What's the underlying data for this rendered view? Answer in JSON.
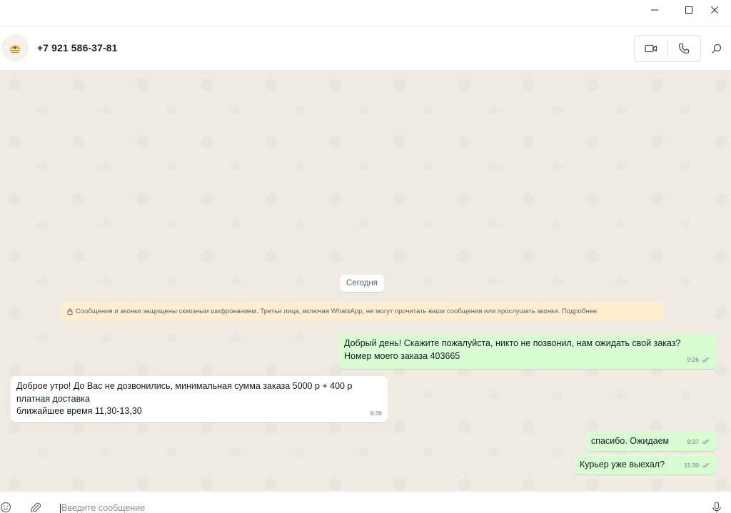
{
  "window": {
    "controls": [
      "minimize-icon",
      "maximize-icon",
      "close-icon"
    ]
  },
  "header": {
    "contact_name": "+7 921 586-37-81",
    "icons": [
      "video-call-icon",
      "voice-call-icon",
      "search-icon"
    ]
  },
  "chat": {
    "date_label": "Сегодня",
    "encryption_notice": "Сообщения и звонки защищены сквозным шифрованием. Третьи лица, включая WhatsApp, не могут прочитать ваши сообщения или прослушать звонки. Подробнее.",
    "messages": [
      {
        "direction": "outgoing",
        "text": "Добрый день! Скажите пожалуйста, никто не позвонил, нам ожидать свой заказ?\nНомер моего заказа 403665",
        "time": "9:26",
        "status": "read"
      },
      {
        "direction": "incoming",
        "text": "Доброе утро! До Вас не дозвонились, минимальная сумма заказа 5000 р + 400 р\nплатная доставка\nближайшее время 11,30-13,30",
        "time": "9:36"
      },
      {
        "direction": "outgoing",
        "text": "спасибо. Ожидаем",
        "time": "9:37",
        "status": "read"
      },
      {
        "direction": "outgoing",
        "text": "Курьер уже выехал?",
        "time": "11:30",
        "status": "read"
      }
    ]
  },
  "composer": {
    "placeholder": "Введите сообщение",
    "icons": [
      "emoji-icon",
      "attach-icon",
      "microphone-icon"
    ]
  },
  "colors": {
    "chat_background": "#efeae2",
    "outgoing_bubble": "#d9fdd3",
    "incoming_bubble": "#ffffff",
    "notice_background": "#ffeecd",
    "muted_text": "#667781"
  }
}
